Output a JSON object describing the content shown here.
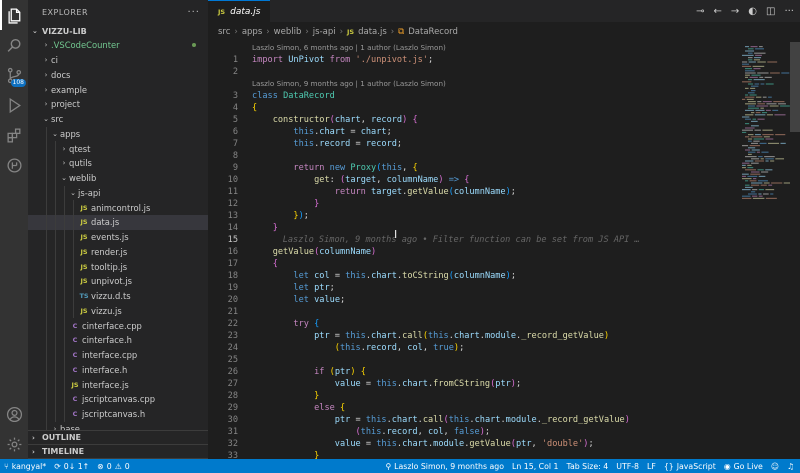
{
  "sidebar": {
    "title": "EXPLORER",
    "project": "VIZZU-LIB",
    "tree": [
      {
        "label": ".VSCodeCounter",
        "depth": 1,
        "kind": "folder",
        "open": false,
        "modified": true
      },
      {
        "label": "ci",
        "depth": 1,
        "kind": "folder",
        "open": false
      },
      {
        "label": "docs",
        "depth": 1,
        "kind": "folder",
        "open": false
      },
      {
        "label": "example",
        "depth": 1,
        "kind": "folder",
        "open": false
      },
      {
        "label": "project",
        "depth": 1,
        "kind": "folder",
        "open": false
      },
      {
        "label": "src",
        "depth": 1,
        "kind": "folder",
        "open": true
      },
      {
        "label": "apps",
        "depth": 2,
        "kind": "folder",
        "open": true
      },
      {
        "label": "qtest",
        "depth": 3,
        "kind": "folder",
        "open": false
      },
      {
        "label": "qutils",
        "depth": 3,
        "kind": "folder",
        "open": false
      },
      {
        "label": "weblib",
        "depth": 3,
        "kind": "folder",
        "open": true
      },
      {
        "label": "js-api",
        "depth": 4,
        "kind": "folder",
        "open": true
      },
      {
        "label": "animcontrol.js",
        "depth": 5,
        "kind": "js"
      },
      {
        "label": "data.js",
        "depth": 5,
        "kind": "js",
        "selected": true
      },
      {
        "label": "events.js",
        "depth": 5,
        "kind": "js"
      },
      {
        "label": "render.js",
        "depth": 5,
        "kind": "js"
      },
      {
        "label": "tooltip.js",
        "depth": 5,
        "kind": "js"
      },
      {
        "label": "unpivot.js",
        "depth": 5,
        "kind": "js"
      },
      {
        "label": "vizzu.d.ts",
        "depth": 5,
        "kind": "ts"
      },
      {
        "label": "vizzu.js",
        "depth": 5,
        "kind": "js"
      },
      {
        "label": "cinterface.cpp",
        "depth": 4,
        "kind": "c"
      },
      {
        "label": "cinterface.h",
        "depth": 4,
        "kind": "c"
      },
      {
        "label": "interface.cpp",
        "depth": 4,
        "kind": "c"
      },
      {
        "label": "interface.h",
        "depth": 4,
        "kind": "c"
      },
      {
        "label": "interface.js",
        "depth": 4,
        "kind": "js"
      },
      {
        "label": "jscriptcanvas.cpp",
        "depth": 4,
        "kind": "c"
      },
      {
        "label": "jscriptcanvas.h",
        "depth": 4,
        "kind": "c"
      },
      {
        "label": "base",
        "depth": 2,
        "kind": "folder",
        "open": false
      }
    ],
    "outline": "OUTLINE",
    "timeline": "TIMELINE",
    "icons": {
      "js": "JS",
      "ts": "TS",
      "c": "C"
    }
  },
  "activity": {
    "scm_badge": "108"
  },
  "editor": {
    "tab": "data.js",
    "tab_icon": "JS",
    "breadcrumb": [
      "src",
      "apps",
      "weblib",
      "js-api",
      "data.js",
      "DataRecord"
    ],
    "lens1": "Laszlo Simon, 6 months ago | 1 author (Laszlo Simon)",
    "lens2": "Laszlo Simon, 9 months ago | 1 author (Laszlo Simon)",
    "blame": "Laszlo Simon, 9 months ago • Filter function can be set from JS API …",
    "lines": [
      {
        "n": "1"
      },
      {
        "n": "2"
      },
      {
        "n": "3"
      },
      {
        "n": "4"
      },
      {
        "n": "5"
      },
      {
        "n": "6"
      },
      {
        "n": "7"
      },
      {
        "n": "8"
      },
      {
        "n": "9"
      },
      {
        "n": "10"
      },
      {
        "n": "11"
      },
      {
        "n": "12"
      },
      {
        "n": "13"
      },
      {
        "n": "14"
      },
      {
        "n": "15"
      },
      {
        "n": "16"
      },
      {
        "n": "17"
      },
      {
        "n": "18"
      },
      {
        "n": "19"
      },
      {
        "n": "20"
      },
      {
        "n": "21"
      },
      {
        "n": "22"
      },
      {
        "n": "23"
      },
      {
        "n": "24"
      },
      {
        "n": "25"
      },
      {
        "n": "26"
      },
      {
        "n": "27"
      },
      {
        "n": "28"
      },
      {
        "n": "29"
      },
      {
        "n": "30"
      },
      {
        "n": "31"
      },
      {
        "n": "32"
      },
      {
        "n": "33"
      }
    ]
  },
  "status": {
    "branch": "kangyal*",
    "sync": "0↓ 1↑",
    "errors": "0",
    "warnings": "0",
    "blame": "Laszlo Simon, 9 months ago",
    "position": "Ln 15, Col 1",
    "tabsize": "Tab Size: 4",
    "encoding": "UTF-8",
    "eol": "LF",
    "language": "JavaScript",
    "golive": "Go Live"
  }
}
